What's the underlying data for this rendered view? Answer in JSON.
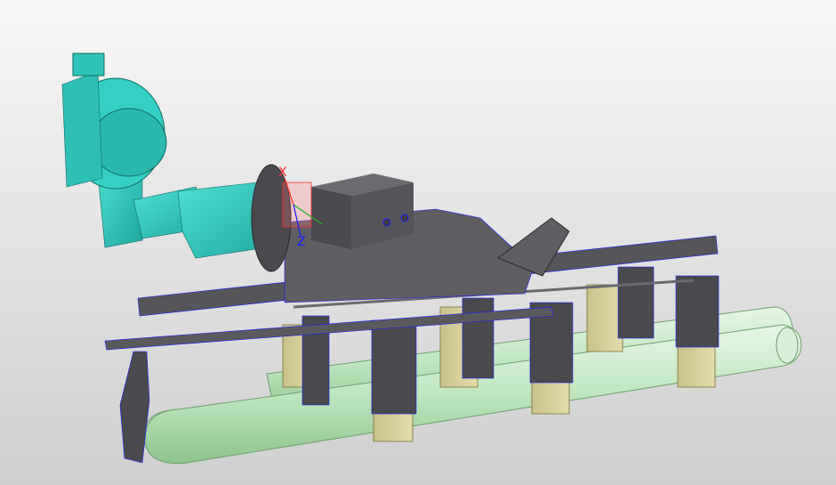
{
  "viewport": {
    "background_top": "#f7f7f7",
    "background_bottom": "#cfcfcf"
  },
  "colors": {
    "robot": "#35cfc4",
    "robot_dark": "#1f9c94",
    "frame": "#5a5a5e",
    "frame_dark": "#3b3b3f",
    "pipe": "#bfe6bf",
    "pipe_edge": "#6f9f6f",
    "tooling_block": "#d6cf9a",
    "edge_lines": "#1a1aff",
    "axis_x": "#ff2a2a",
    "axis_y": "#22aa22",
    "axis_z": "#1a1aff"
  },
  "triad": {
    "x_label": "X",
    "y_label": "Y",
    "z_label": "Z"
  }
}
